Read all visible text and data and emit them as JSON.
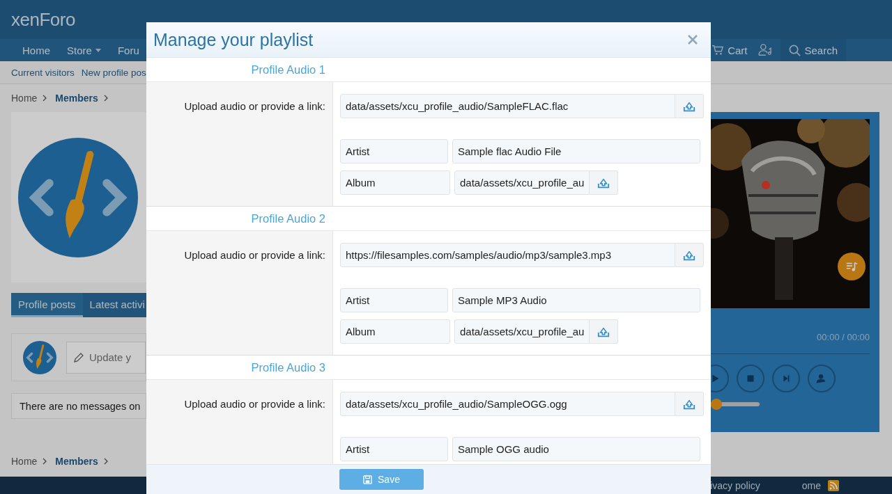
{
  "header": {
    "logo": "xenForo"
  },
  "nav": {
    "items": [
      {
        "label": "Home",
        "dropdown": false
      },
      {
        "label": "Store",
        "dropdown": true
      },
      {
        "label": "Foru",
        "dropdown": false
      }
    ],
    "cart": "Cart",
    "search": "Search"
  },
  "subnav": [
    "Current visitors",
    "New profile pos"
  ],
  "breadcrumb": [
    {
      "label": "Home",
      "bold": false
    },
    {
      "label": "Members",
      "bold": true
    }
  ],
  "profile_tabs": [
    {
      "label": "Profile posts",
      "selected": true
    },
    {
      "label": "Latest activi",
      "selected": false
    }
  ],
  "status": {
    "placeholder": "Update y"
  },
  "no_messages": "There are no messages on",
  "bottom_breadcrumb": [
    {
      "label": "Home",
      "bold": false
    },
    {
      "label": "Members",
      "bold": true
    }
  ],
  "footer_links": [
    "ivacy policy",
    "ome"
  ],
  "player": {
    "time": "00:00 / 00:00",
    "volume": {
      "level": 0.35
    }
  },
  "modal": {
    "title": "Manage your playlist",
    "save": "Save",
    "sections": [
      {
        "title": "Profile Audio 1",
        "link_label": "Upload audio or provide a link:",
        "link": "data/assets/xcu_profile_audio/SampleFLAC.flac",
        "artist_label": "Artist",
        "artist": "Sample flac Audio File",
        "album_label": "Album",
        "album": "data/assets/xcu_profile_au"
      },
      {
        "title": "Profile Audio 2",
        "link_label": "Upload audio or provide a link:",
        "link": "https://filesamples.com/samples/audio/mp3/sample3.mp3",
        "artist_label": "Artist",
        "artist": "Sample MP3 Audio",
        "album_label": "Album",
        "album": "data/assets/xcu_profile_au"
      },
      {
        "title": "Profile Audio 3",
        "link_label": "Upload audio or provide a link:",
        "link": "data/assets/xcu_profile_audio/SampleOGG.ogg",
        "artist_label": "Artist",
        "artist": "Sample OGG audio"
      }
    ]
  }
}
